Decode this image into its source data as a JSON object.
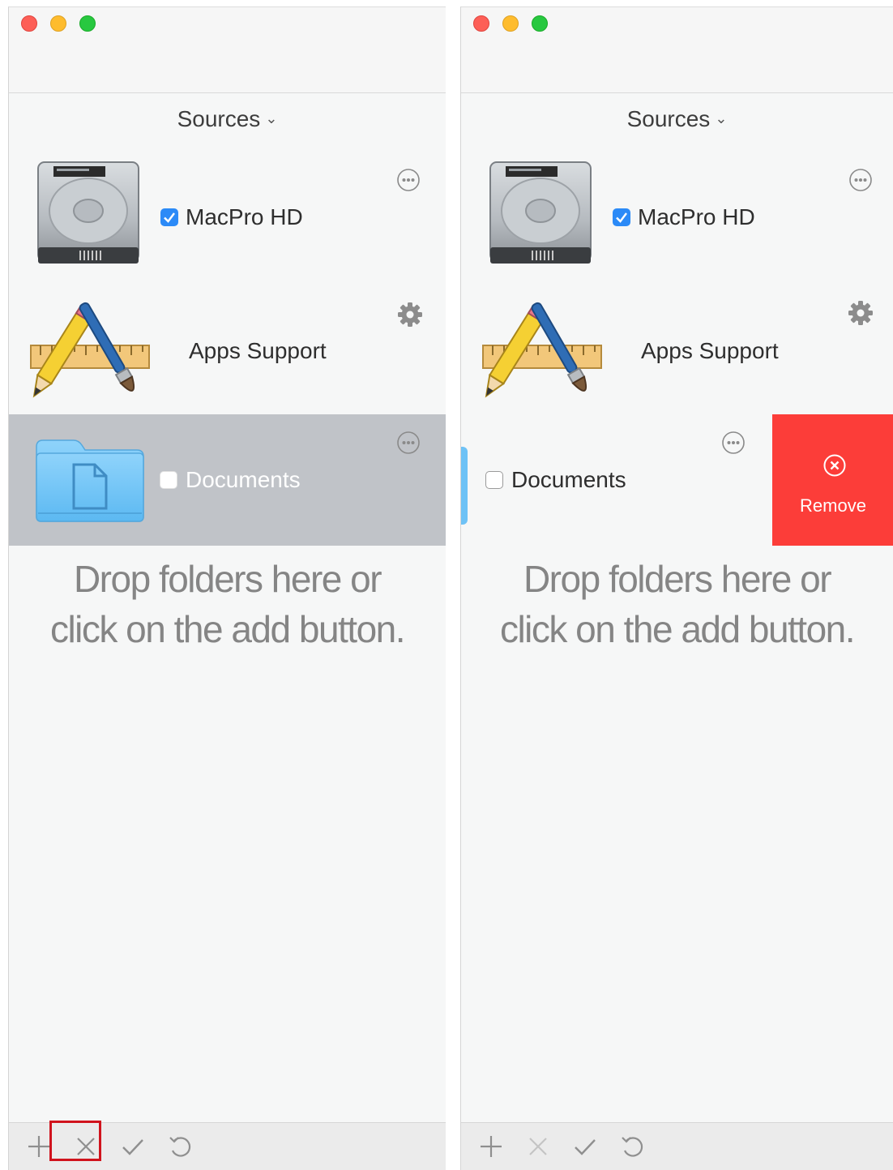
{
  "left_window": {
    "header": "Sources",
    "sources": [
      {
        "name": "MacPro HD",
        "checked": true,
        "icon": "hard-drive-icon",
        "action_icon": "more-icon"
      },
      {
        "name": "Apps Support",
        "icon": "applications-icon",
        "action_icon": "gear-icon"
      },
      {
        "name": "Documents",
        "checked": false,
        "selected": true,
        "icon": "folder-icon",
        "action_icon": "more-icon"
      }
    ],
    "drop_line1": "Drop folders here or",
    "drop_line2": "click on the add button.",
    "toolbar": [
      "plus-icon",
      "close-icon",
      "checkmark-icon",
      "undo-icon"
    ],
    "highlighted_toolbar_item": "close-icon"
  },
  "right_window": {
    "header": "Sources",
    "sources": [
      {
        "name": "MacPro HD",
        "checked": true,
        "icon": "hard-drive-icon",
        "action_icon": "more-icon"
      },
      {
        "name": "Apps Support",
        "icon": "applications-icon",
        "action_icon": "gear-icon"
      },
      {
        "name": "Documents",
        "checked": false,
        "swiped": true,
        "icon": "folder-icon",
        "action_icon": "more-icon"
      }
    ],
    "remove_label": "Remove",
    "drop_line1": "Drop folders here or",
    "drop_line2": "click on the add button.",
    "toolbar": [
      "plus-icon",
      "close-icon",
      "checkmark-icon",
      "undo-icon"
    ]
  },
  "colors": {
    "window_bg": "#f6f7f7",
    "selection": "#c0c3c8",
    "checkbox_blue": "#2b8af7",
    "remove_red": "#fc3d39",
    "highlight_red": "#d0131d"
  }
}
